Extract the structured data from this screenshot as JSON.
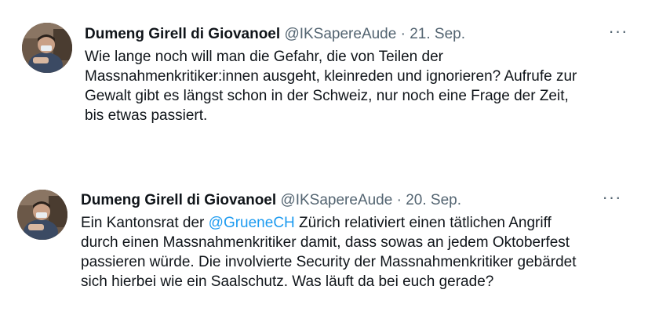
{
  "tweets": [
    {
      "display_name": "Dumeng Girell di Giovanoel",
      "handle": "@IKSapereAude",
      "separator": "·",
      "date": "21. Sep.",
      "more_label": "···",
      "text_lines": [
        "Wie lange noch will man die Gefahr, die von Teilen der",
        "Massnahmenkritiker:innen ausgeht, kleinreden und ignorieren? Aufrufe zur",
        "Gewalt gibt es längst schon in der Schweiz, nur noch eine Frage der Zeit,",
        "bis etwas passiert."
      ]
    },
    {
      "display_name": "Dumeng Girell di Giovanoel",
      "handle": "@IKSapereAude",
      "separator": "·",
      "date": "20. Sep.",
      "more_label": "···",
      "text_before_mention": "Ein Kantonsrat der ",
      "mention": "@GrueneCH",
      "text_after_mention": " Zürich relativiert einen tätlichen Angriff",
      "text_lines": [
        "durch einen Massnahmenkritiker damit, dass sowas an jedem Oktoberfest",
        "passieren würde. Die involvierte Security der Massnahmenkritiker gebärdet",
        "sich hierbei wie ein Saalschutz. Was läuft da bei euch gerade?"
      ]
    }
  ],
  "colors": {
    "text": "#0f1419",
    "secondary": "#536471",
    "link": "#1d9bf0",
    "background": "#ffffff"
  }
}
